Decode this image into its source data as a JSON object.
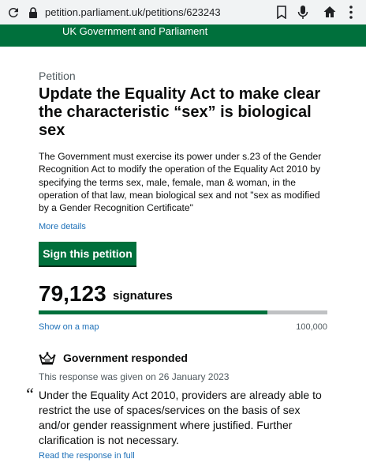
{
  "browser": {
    "url": "petition.parliament.uk/petitions/623243"
  },
  "banner": {
    "text": "UK Government and Parliament"
  },
  "petition": {
    "caption": "Petition",
    "title": "Update the Equality Act to make clear the characteristic “sex” is biological sex",
    "summary": "The Government must exercise its power under s.23 of the Gender Recognition Act to modify the operation of the Equality Act 2010 by specifying the terms sex, male, female, man & woman, in the operation of that law, mean biological sex and not \"sex as modified by a Gender Recognition Certificate\"",
    "more_details": "More details",
    "sign_button": "Sign this petition"
  },
  "signatures": {
    "count": "79,123",
    "label": "signatures",
    "progress_fraction": 0.79123,
    "show_map": "Show on a map",
    "target": "100,000"
  },
  "response": {
    "heading": "Government responded",
    "date_text": "This response was given on 26 January 2023",
    "quote_mark": "“",
    "quote": "Under the Equality Act 2010, providers are already able to restrict the use of spaces/services on the basis of sex and/or gender reassignment where justified. Further clarification is not necessary.",
    "read_full": "Read the response in full"
  },
  "colors": {
    "brand_green": "#00703c",
    "link_blue": "#1d70b8",
    "secondary_text": "#505a5f",
    "progress_track": "#bfc1c3"
  },
  "icons": [
    "reload-icon",
    "lock-icon",
    "bookmark-icon",
    "microphone-icon",
    "home-icon",
    "menu-icon",
    "crown-icon"
  ]
}
